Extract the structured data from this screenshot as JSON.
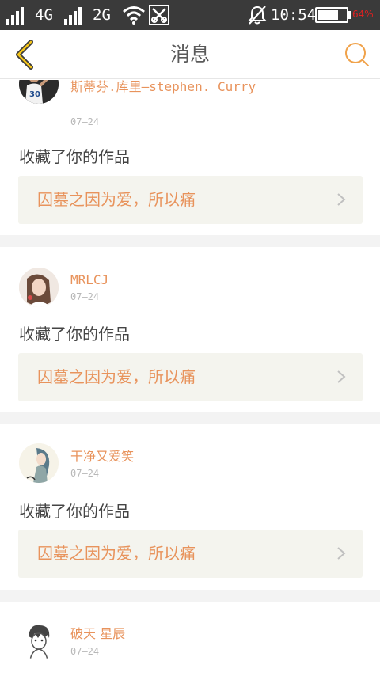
{
  "status_bar": {
    "network_1": "4G",
    "network_2": "2G",
    "time": "10:54",
    "battery_label": "64%",
    "icons": [
      "signal-icon",
      "signal-icon",
      "wifi-icon",
      "data-transfer-icon",
      "alarm-off-icon",
      "battery-icon"
    ]
  },
  "nav": {
    "title": "消息",
    "back_icon": "chevron-left-icon",
    "search_icon": "search-icon",
    "accent_color": "#f0a24a"
  },
  "messages": [
    {
      "user": "斯蒂芬.库里—stephen. Curry",
      "date": "07—24",
      "action": "收藏了你的作品",
      "work_title": "囚墓之因为爱，所以痛",
      "avatar_icon": "basketball-player-avatar"
    },
    {
      "user": "MRLCJ",
      "date": "07—24",
      "action": "收藏了你的作品",
      "work_title": "囚墓之因为爱，所以痛",
      "avatar_icon": "girl-avatar"
    },
    {
      "user": "干净又爱笑",
      "date": "07—24",
      "action": "收藏了你的作品",
      "work_title": "囚墓之因为爱，所以痛",
      "avatar_icon": "anime-girl-avatar"
    },
    {
      "user": "破天 星辰",
      "date": "07—24",
      "action": "",
      "work_title": "",
      "avatar_icon": "sketch-boy-avatar"
    }
  ],
  "colors": {
    "username": "#e8935c",
    "work_link_bg": "#f4f4ee",
    "separator": "#f3f3f3"
  }
}
